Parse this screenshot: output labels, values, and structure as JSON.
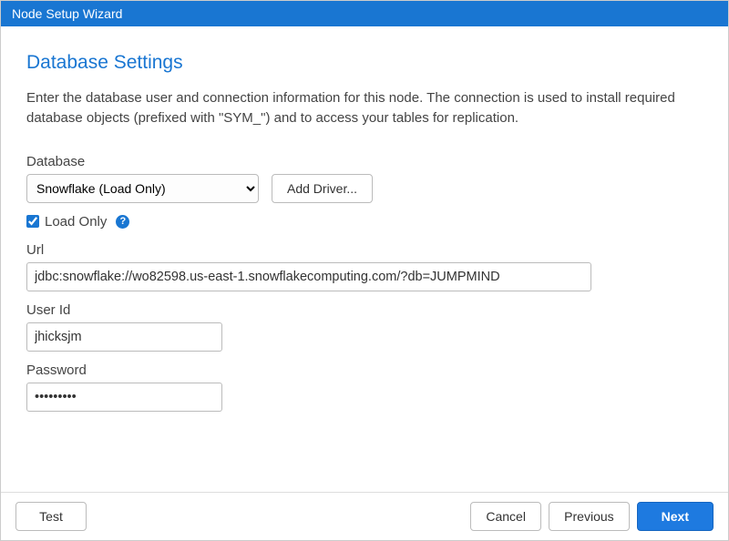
{
  "window": {
    "title": "Node Setup Wizard"
  },
  "page": {
    "heading": "Database Settings",
    "intro": "Enter the database user and connection information for this node. The connection is used to install required database objects (prefixed with \"SYM_\") and to access your tables for replication."
  },
  "labels": {
    "database": "Database",
    "loadOnly": "Load Only",
    "url": "Url",
    "userId": "User Id",
    "password": "Password"
  },
  "database": {
    "selected": "Snowflake (Load Only)",
    "addDriver": "Add Driver..."
  },
  "loadOnlyChecked": true,
  "fields": {
    "url": "jdbc:snowflake://wo82598.us-east-1.snowflakecomputing.com/?db=JUMPMIND",
    "userId": "jhicksjm",
    "password": "•••••••••"
  },
  "footer": {
    "test": "Test",
    "cancel": "Cancel",
    "previous": "Previous",
    "next": "Next"
  }
}
